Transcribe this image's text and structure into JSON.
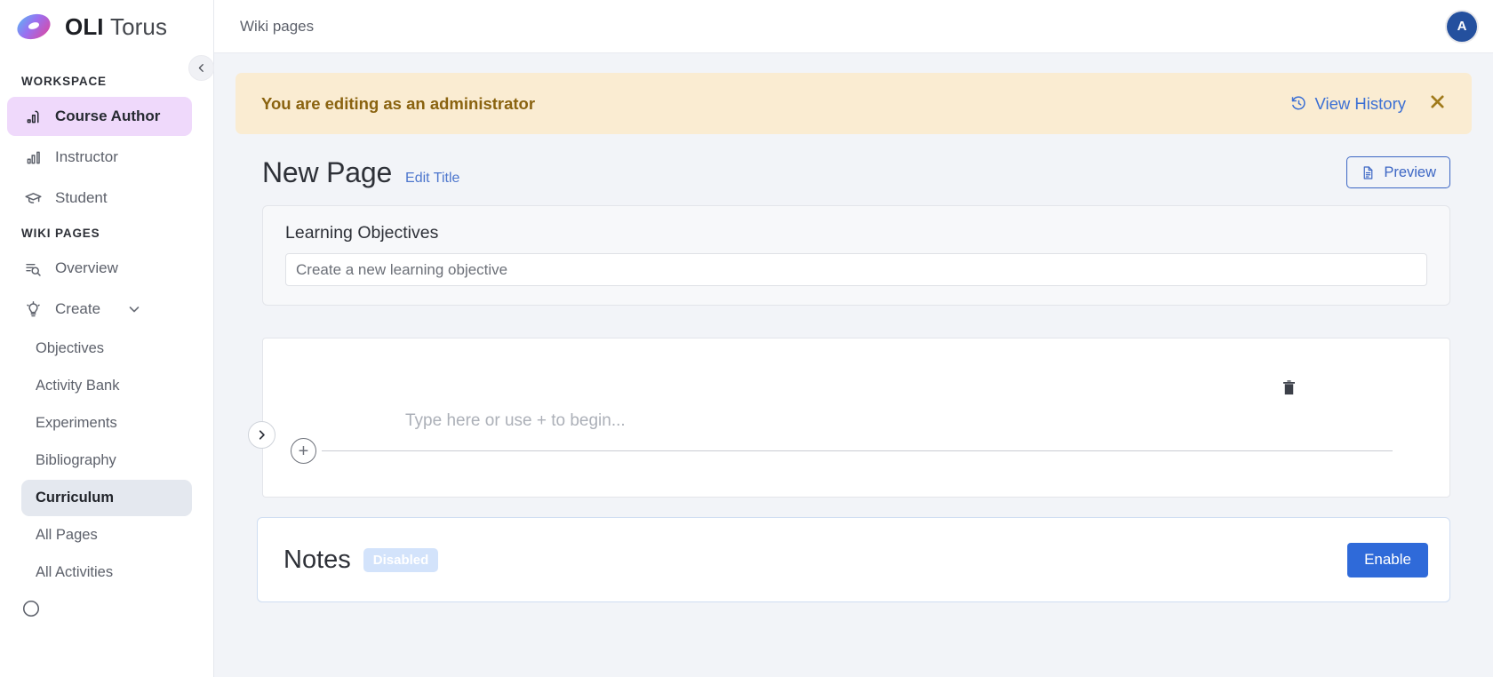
{
  "brand": {
    "name_bold": "OLI",
    "name_light": "Torus",
    "logo_icon": "torus-logo-icon"
  },
  "sidebar": {
    "collapse_icon": "chevron-left-icon",
    "workspace_title": "WORKSPACE",
    "workspace_items": [
      {
        "label": "Course Author",
        "icon": "course-author-icon",
        "active": true
      },
      {
        "label": "Instructor",
        "icon": "bar-chart-icon",
        "active": false
      },
      {
        "label": "Student",
        "icon": "graduation-cap-icon",
        "active": false
      }
    ],
    "wiki_title": "WIKI PAGES",
    "wiki_items": [
      {
        "label": "Overview",
        "icon": "list-search-icon"
      },
      {
        "label": "Create",
        "icon": "lightbulb-icon",
        "caret": "chevron-down-icon"
      }
    ],
    "create_children": [
      {
        "label": "Objectives",
        "active": false
      },
      {
        "label": "Activity Bank",
        "active": false
      },
      {
        "label": "Experiments",
        "active": false
      },
      {
        "label": "Bibliography",
        "active": false
      },
      {
        "label": "Curriculum",
        "active": true
      },
      {
        "label": "All Pages",
        "active": false
      },
      {
        "label": "All Activities",
        "active": false
      }
    ]
  },
  "topbar": {
    "breadcrumb": "Wiki pages",
    "avatar_initial": "A",
    "avatar_color": "#24509e"
  },
  "admin_banner": {
    "message": "You are editing as an administrator",
    "history_label": "View History",
    "history_icon": "history-clock-icon",
    "close_icon": "close-icon",
    "background": "#faecd2",
    "text_color": "#8a6310"
  },
  "page": {
    "title": "New Page",
    "edit_title_label": "Edit Title",
    "preview_label": "Preview",
    "preview_icon": "document-icon"
  },
  "objectives": {
    "label": "Learning Objectives",
    "input_placeholder": "Create a new learning objective",
    "input_value": ""
  },
  "editor": {
    "placeholder": "Type here or use + to begin...",
    "trash_icon": "trash-icon",
    "add_icon": "plus-circle-icon",
    "side_toggle_icon": "chevron-right-icon"
  },
  "notes": {
    "title": "Notes",
    "badge": "Disabled",
    "enable_label": "Enable",
    "enable_color": "#2f6ad9"
  }
}
